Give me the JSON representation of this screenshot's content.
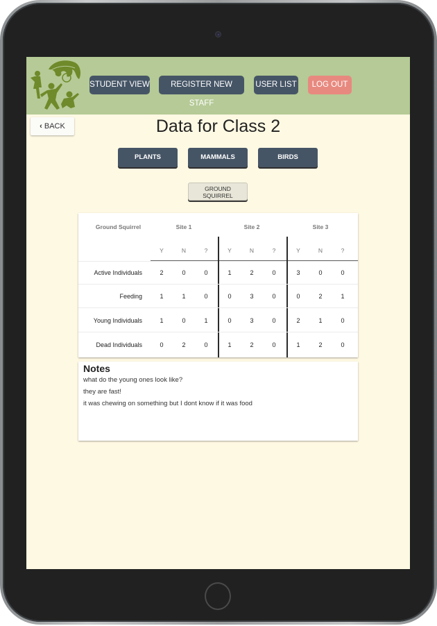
{
  "nav": {
    "logo_icon": "children-oak-leaf-logo",
    "buttons": [
      {
        "label": "STUDENT VIEW"
      },
      {
        "label": "REGISTER NEW STAFF"
      },
      {
        "label": "USER LIST"
      },
      {
        "label": "LOG OUT"
      }
    ]
  },
  "back": {
    "icon": "chevron-left-icon",
    "label": "BACK"
  },
  "page_title": "Data for Class 2",
  "categories": [
    {
      "label": "PLANTS"
    },
    {
      "label": "MAMMALS"
    },
    {
      "label": "BIRDS"
    }
  ],
  "subcategory": {
    "line1": "GROUND",
    "line2": "SQUIRREL"
  },
  "table": {
    "species": "Ground Squirrel",
    "sites": [
      "Site 1",
      "Site 2",
      "Site 3"
    ],
    "subheaders": [
      "Y",
      "N",
      "?"
    ],
    "rows": [
      {
        "label": "Active Individuals",
        "values": [
          "2",
          "0",
          "0",
          "1",
          "2",
          "0",
          "3",
          "0",
          "0"
        ]
      },
      {
        "label": "Feeding",
        "values": [
          "1",
          "1",
          "0",
          "0",
          "3",
          "0",
          "0",
          "2",
          "1"
        ]
      },
      {
        "label": "Young Individuals",
        "values": [
          "1",
          "0",
          "1",
          "0",
          "3",
          "0",
          "2",
          "1",
          "0"
        ]
      },
      {
        "label": "Dead Individuals",
        "values": [
          "0",
          "2",
          "0",
          "1",
          "2",
          "0",
          "1",
          "2",
          "0"
        ]
      }
    ]
  },
  "notes": {
    "title": "Notes",
    "lines": [
      "what do the young ones look like?",
      "they are fast!",
      "it was chewing on something but I dont know if it was food"
    ]
  }
}
